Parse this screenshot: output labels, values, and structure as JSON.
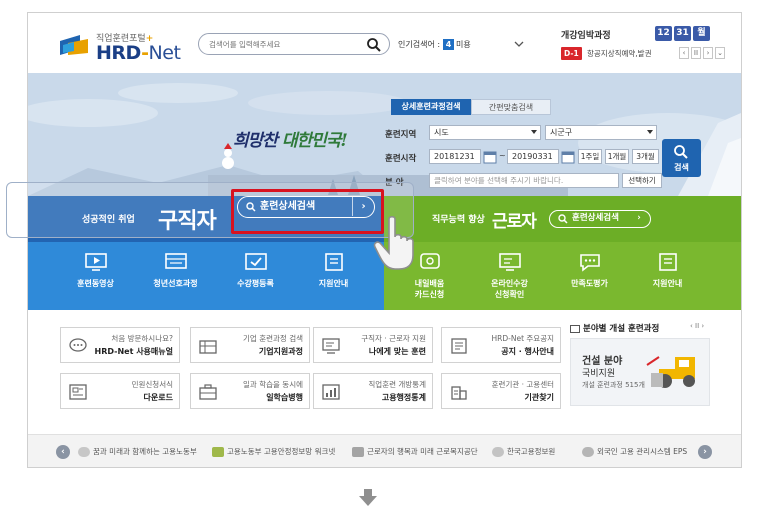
{
  "header": {
    "logo_sub": "직업훈련포털",
    "logo_plus": "+",
    "logo_main_a": "HRD",
    "logo_main_dash": "-",
    "logo_main_b": "Net",
    "search_placeholder": "검색어를 입력해주세요",
    "popular_label": "인기검색어 :",
    "popular_rank": "4",
    "popular_term": "미용"
  },
  "schedule": {
    "title": "개강임박과정",
    "month": "12",
    "day": "31",
    "weekday": "월",
    "dday": "D-1",
    "item": "항공지상직예약,발권",
    "ctrl_prev": "‹",
    "ctrl_pause": "II",
    "ctrl_next": "›",
    "ctrl_down": "⌄"
  },
  "hero": {
    "slogan_a": "희망찬 ",
    "slogan_b": "대한민국!"
  },
  "search_form": {
    "tab_detail": "상세훈련과정검색",
    "tab_simple": "간편맞춤검색",
    "region_label": "훈련지역",
    "region_city": "시도",
    "region_district": "시군구",
    "start_label": "훈련시작",
    "date_from": "20181231",
    "date_sep": "~",
    "date_to": "20190331",
    "period_1w": "1주일",
    "period_1m": "1개월",
    "period_3m": "3개월",
    "field_label": "분    야",
    "field_placeholder": "클릭하여 분야를 선택해 주시기 바랍니다.",
    "select_button": "선택하기",
    "search_button": "검색"
  },
  "jobbar": {
    "left_sub": "성공적인 취업",
    "left_main": "구직자",
    "left_btn": "훈련상세검색",
    "right_sub": "직무능력 향상",
    "right_main": "근로자",
    "right_btn": "훈련상세검색"
  },
  "quick_left": [
    {
      "label": "훈련동영상",
      "icon": "video-icon"
    },
    {
      "label": "청년선호과정",
      "icon": "hrd-card-icon"
    },
    {
      "label": "수강평등록",
      "icon": "review-icon"
    },
    {
      "label": "지원안내",
      "icon": "guide-icon"
    }
  ],
  "quick_right": [
    {
      "label_a": "내일배움",
      "label_b": "카드신청",
      "icon": "card-icon"
    },
    {
      "label_a": "온라인수강",
      "label_b": "신청확인",
      "icon": "online-icon"
    },
    {
      "label_a": "만족도평가",
      "label_b": "",
      "icon": "survey-icon"
    },
    {
      "label_a": "지원안내",
      "label_b": "",
      "icon": "guide-icon"
    }
  ],
  "services": [
    {
      "line1": "처음 방문하시나요?",
      "line2": "HRD-Net 사용매뉴얼",
      "icon": "chat-icon"
    },
    {
      "line1": "기업 훈련과정 검색",
      "line2": "기업지원과정",
      "icon": "building-icon"
    },
    {
      "line1": "구직자 · 근로자 지원",
      "line2": "나에게 맞는 훈련",
      "icon": "monitor-icon"
    },
    {
      "line1": "HRD-Net 주요공지",
      "line2": "공지 · 행사안내",
      "icon": "notice-icon"
    },
    {
      "line1": "민원신청서식",
      "line2": "다운로드",
      "icon": "form-icon"
    },
    {
      "line1": "일과 학습을 동시에",
      "line2": "일학습병행",
      "icon": "briefcase-icon"
    },
    {
      "line1": "직업훈련 개방통계",
      "line2": "고용행정통계",
      "icon": "stats-icon"
    },
    {
      "line1": "훈련기관 · 고용센터",
      "line2": "기관찾기",
      "icon": "office-icon"
    }
  ],
  "banner": {
    "heading": "분야별 개설 훈련과정",
    "ctrl": "‹ II ›",
    "title": "건설 분야",
    "subtitle": "국비지원",
    "note": "개설 훈련과정 515개"
  },
  "footer": {
    "prev": "‹",
    "next": "›",
    "links": [
      {
        "label": "꿈과 미래과 함께하는 고용노동부"
      },
      {
        "label": "고용노동부 고용안정정보망 워크넷"
      },
      {
        "label": "근로자의 행복과 미래 근로복지공단"
      },
      {
        "label": "한국고용정보원"
      },
      {
        "label": "외국인 고용 관리시스템 EPS"
      }
    ]
  },
  "colors": {
    "job_seeker_blue": "#2264b2",
    "worker_green": "#6cae26",
    "highlight_red": "#d8121f",
    "brand_navy": "#1b3f86"
  }
}
